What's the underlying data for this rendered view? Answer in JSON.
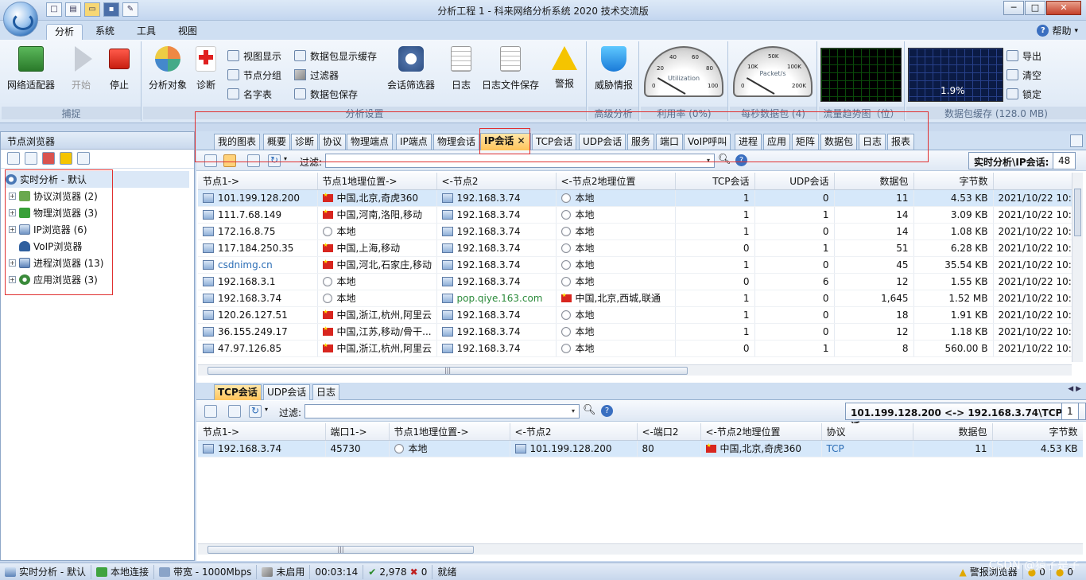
{
  "window": {
    "title": "分析工程 1 - 科来网络分析系统 2020 技术交流版",
    "controls": [
      "─",
      "□",
      "✕"
    ]
  },
  "quick_access": [
    "new-doc-icon",
    "open-icon",
    "folder-icon",
    "save-icon",
    "edit-icon"
  ],
  "menu_tabs": [
    "分析",
    "系统",
    "工具",
    "视图"
  ],
  "help_label": "帮助",
  "ribbon": {
    "capture": {
      "label": "捕捉",
      "buttons": [
        "网络适配器",
        "开始",
        "停止"
      ]
    },
    "analysis_settings": {
      "label": "分析设置",
      "big_buttons": [
        "分析对象",
        "诊断"
      ],
      "small_col1": [
        "视图显示",
        "节点分组",
        "名字表"
      ],
      "small_col2": [
        "数据包显示缓存",
        "过滤器",
        "数据包保存"
      ],
      "big_buttons2": [
        "会话筛选器",
        "日志",
        "日志文件保存",
        "警报"
      ]
    },
    "advanced": {
      "label": "高级分析",
      "button": "威胁情报"
    },
    "utilization": {
      "label": "利用率 (0%)",
      "gauge_text": "Utilization",
      "ticks": [
        "20",
        "40",
        "60",
        "80",
        "0",
        "100"
      ]
    },
    "pps": {
      "label": "每秒数据包 (4)",
      "gauge_text": "Packet/s",
      "ticks": [
        "10K",
        "50K",
        "100K",
        "0",
        "200K"
      ]
    },
    "trend": {
      "label": "流量趋势图（位）"
    },
    "buffer": {
      "label": "数据包缓存 (128.0 MB)",
      "percent": "1.9%",
      "side_buttons": [
        "导出",
        "清空",
        "锁定"
      ]
    }
  },
  "node_browser": {
    "title": "节点浏览器",
    "tree": [
      {
        "label": "实时分析 - 默认",
        "root": true
      },
      {
        "label": "协议浏览器 (2)"
      },
      {
        "label": "物理浏览器 (3)"
      },
      {
        "label": "IP浏览器 (6)"
      },
      {
        "label": "VoIP浏览器"
      },
      {
        "label": "进程浏览器 (13)"
      },
      {
        "label": "应用浏览器 (3)"
      }
    ]
  },
  "view_tabs": [
    "我的图表",
    "概要",
    "诊断",
    "协议",
    "物理端点",
    "IP端点",
    "物理会话",
    "IP会话",
    "TCP会话",
    "UDP会话",
    "服务",
    "端口",
    "VoIP呼叫",
    "进程",
    "应用",
    "矩阵",
    "数据包",
    "日志",
    "报表"
  ],
  "active_view_tab": "IP会话",
  "upper": {
    "filter_label": "过滤:",
    "filter_value": "",
    "path_label": "实时分析\\IP会话:",
    "count": "48",
    "columns": [
      "节点1->",
      "节点1地理位置->",
      "<-节点2",
      "<-节点2地理位置",
      "TCP会话",
      "UDP会话",
      "数据包",
      "字节数",
      ""
    ],
    "rows": [
      {
        "n1": "101.199.128.200",
        "g1": "中国,北京,奇虎360",
        "n2": "192.168.3.74",
        "g2": "本地",
        "tcp": "1",
        "udp": "0",
        "pk": "11",
        "bytes": "4.53 KB",
        "time": "2021/10/22 10:",
        "g1flag": true,
        "g2flag": false
      },
      {
        "n1": "111.7.68.149",
        "g1": "中国,河南,洛阳,移动",
        "n2": "192.168.3.74",
        "g2": "本地",
        "tcp": "1",
        "udp": "1",
        "pk": "14",
        "bytes": "3.09 KB",
        "time": "2021/10/22 10:",
        "g1flag": true,
        "g2flag": false
      },
      {
        "n1": "172.16.8.75",
        "g1": "本地",
        "n2": "192.168.3.74",
        "g2": "本地",
        "tcp": "1",
        "udp": "0",
        "pk": "14",
        "bytes": "1.08 KB",
        "time": "2021/10/22 10:",
        "g1flag": false,
        "g2flag": false
      },
      {
        "n1": "117.184.250.35",
        "g1": "中国,上海,移动",
        "n2": "192.168.3.74",
        "g2": "本地",
        "tcp": "0",
        "udp": "1",
        "pk": "51",
        "bytes": "6.28 KB",
        "time": "2021/10/22 10:",
        "g1flag": true,
        "g2flag": false
      },
      {
        "n1": "csdnimg.cn",
        "g1": "中国,河北,石家庄,移动",
        "n2": "192.168.3.74",
        "g2": "本地",
        "tcp": "1",
        "udp": "0",
        "pk": "45",
        "bytes": "35.54 KB",
        "time": "2021/10/22 10:",
        "g1flag": true,
        "g2flag": false,
        "n1link": true
      },
      {
        "n1": "192.168.3.1",
        "g1": "本地",
        "n2": "192.168.3.74",
        "g2": "本地",
        "tcp": "0",
        "udp": "6",
        "pk": "12",
        "bytes": "1.55 KB",
        "time": "2021/10/22 10:",
        "g1flag": false,
        "g2flag": false
      },
      {
        "n1": "192.168.3.74",
        "g1": "本地",
        "n2": "pop.qiye.163.com",
        "g2": "中国,北京,西城,联通",
        "tcp": "1",
        "udp": "0",
        "pk": "1,645",
        "bytes": "1.52 MB",
        "time": "2021/10/22 10:",
        "g1flag": false,
        "g2flag": true,
        "n2link": true
      },
      {
        "n1": "120.26.127.51",
        "g1": "中国,浙江,杭州,阿里云",
        "n2": "192.168.3.74",
        "g2": "本地",
        "tcp": "1",
        "udp": "0",
        "pk": "18",
        "bytes": "1.91 KB",
        "time": "2021/10/22 10:",
        "g1flag": true,
        "g2flag": false
      },
      {
        "n1": "36.155.249.17",
        "g1": "中国,江苏,移动/骨干...",
        "n2": "192.168.3.74",
        "g2": "本地",
        "tcp": "1",
        "udp": "0",
        "pk": "12",
        "bytes": "1.18 KB",
        "time": "2021/10/22 10:",
        "g1flag": true,
        "g2flag": false
      },
      {
        "n1": "47.97.126.85",
        "g1": "中国,浙江,杭州,阿里云",
        "n2": "192.168.3.74",
        "g2": "本地",
        "tcp": "0",
        "udp": "1",
        "pk": "8",
        "bytes": "560.00 B",
        "time": "2021/10/22 10:",
        "g1flag": true,
        "g2flag": false
      }
    ]
  },
  "bottom_tabs": [
    "TCP会话",
    "UDP会话",
    "日志"
  ],
  "lower": {
    "filter_label": "过滤:",
    "path_label": "101.199.128.200 <-> 192.168.3.74\\TCP会话:",
    "count": "1",
    "columns": [
      "节点1->",
      "端口1->",
      "节点1地理位置->",
      "<-节点2",
      "<-端口2",
      "<-节点2地理位置",
      "协议",
      "数据包",
      "字节数"
    ],
    "rows": [
      {
        "n1": "192.168.3.74",
        "p1": "45730",
        "g1": "本地",
        "n2": "101.199.128.200",
        "p2": "80",
        "g2": "中国,北京,奇虎360",
        "proto": "TCP",
        "pk": "11",
        "bytes": "4.53 KB"
      }
    ]
  },
  "status_bar": {
    "mode": "实时分析 - 默认",
    "conn": "本地连接",
    "bandwidth": "带宽 - 1000Mbps",
    "filter": "未启用",
    "time": "00:03:14",
    "ok_count": "2,978",
    "err_count": "0",
    "state": "就绪",
    "alarm": "警报浏览器",
    "alarm_a": "0",
    "alarm_b": "0"
  },
  "watermark": "CSDN @猿子是子"
}
